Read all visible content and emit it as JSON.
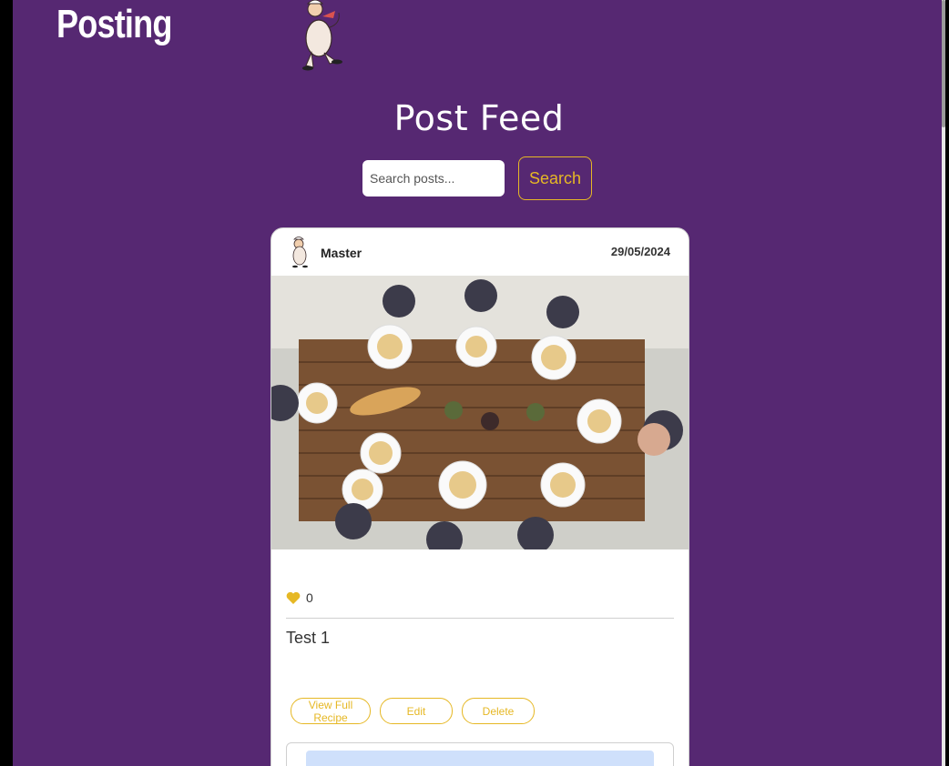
{
  "header": {
    "brand": "Posting",
    "mascot_icon": "chef-mascot-icon"
  },
  "feed": {
    "title": "Post Feed",
    "search": {
      "placeholder": "Search posts...",
      "value": "",
      "button_label": "Search"
    }
  },
  "post": {
    "author": "Master",
    "date": "29/05/2024",
    "image_description_icon": "dinner-table-photo",
    "likes": "0",
    "title": "Test 1",
    "actions": {
      "view": "View Full Recipe",
      "edit": "Edit",
      "delete": "Delete"
    }
  },
  "colors": {
    "background": "#562872",
    "accent": "#e6b825",
    "card": "#ffffff"
  }
}
